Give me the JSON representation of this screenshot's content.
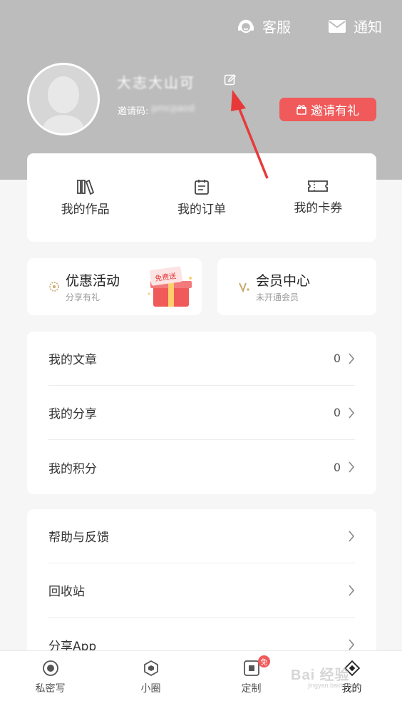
{
  "colors": {
    "header_bg": "#bcbcbc",
    "accent": "#f05a5a",
    "page_bg": "#f6f6f6",
    "vip_gold": "#c9a96a"
  },
  "top_actions": [
    {
      "label": "客服",
      "icon": "headset-icon"
    },
    {
      "label": "通知",
      "icon": "mail-icon"
    }
  ],
  "profile": {
    "name": "大志大山可",
    "invite_label": "邀请码:",
    "invite_code": "pmcpaod",
    "invite_button": "邀请有礼"
  },
  "quick_links": [
    {
      "label": "我的作品",
      "icon": "books-icon"
    },
    {
      "label": "我的订单",
      "icon": "clipboard-icon"
    },
    {
      "label": "我的卡券",
      "icon": "ticket-icon"
    }
  ],
  "promo": {
    "left": {
      "title": "优惠活动",
      "subtitle": "分享有礼",
      "gift_text": "免费送"
    },
    "right": {
      "title": "会员中心",
      "subtitle": "未开通会员"
    }
  },
  "stats_list": [
    {
      "label": "我的文章",
      "value": "0"
    },
    {
      "label": "我的分享",
      "value": "0"
    },
    {
      "label": "我的积分",
      "value": "0"
    }
  ],
  "settings_list": [
    {
      "label": "帮助与反馈"
    },
    {
      "label": "回收站"
    },
    {
      "label": "分享App"
    }
  ],
  "tabbar": {
    "tabs": [
      {
        "label": "私密写",
        "icon": "record-icon"
      },
      {
        "label": "小圈",
        "icon": "hexagon-icon"
      },
      {
        "label": "定制",
        "icon": "square-icon",
        "badge": "免"
      },
      {
        "label": "我的",
        "icon": "diamond-icon"
      }
    ]
  },
  "watermark": {
    "text": "Bai 经验",
    "sub": "jingyan.baidu.com"
  }
}
